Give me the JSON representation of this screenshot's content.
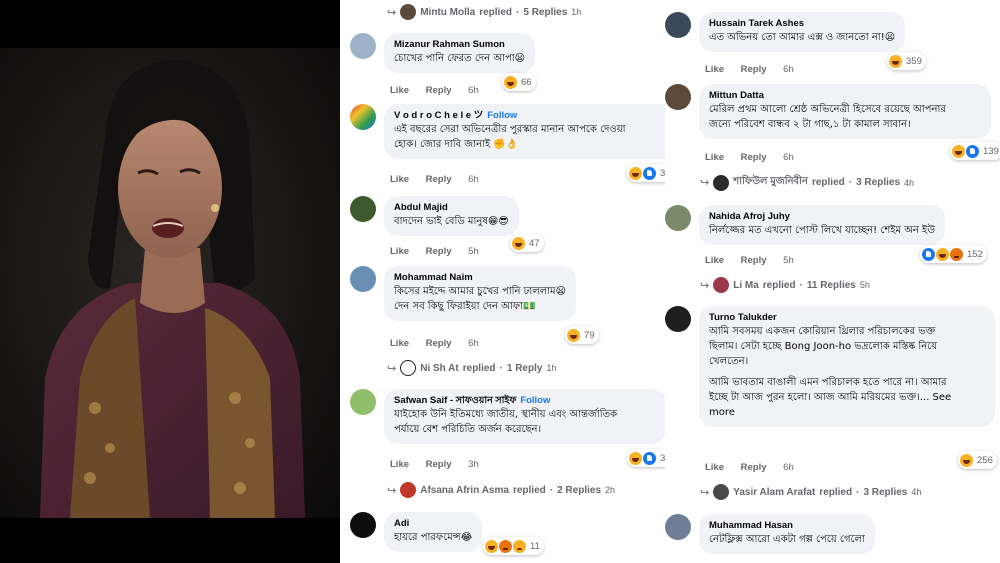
{
  "left_column": {
    "top_reply": {
      "author": "Mintu Molla",
      "action": "replied",
      "count": "5 Replies",
      "time": "1h"
    },
    "comments": [
      {
        "name": "Mizanur Rahman Sumon",
        "follow": "",
        "lines": [
          "চোখের পানি ফেরত দেন আপা😦"
        ],
        "like": "Like",
        "reply": "Reply",
        "time": "6h",
        "reactions": [
          "haha"
        ],
        "count": "66"
      },
      {
        "name": "V o d r o C h e l e ツ",
        "follow": "Follow",
        "lines": [
          "এই বছরের সেরা অভিনেত্রীর পুরস্কার মানান আপকে দেওয়া",
          "হোক। জোর দাবি জানাই ✊👌"
        ],
        "like": "Like",
        "reply": "Reply",
        "time": "6h",
        "reactions": [
          "haha",
          "like"
        ],
        "count": "30"
      },
      {
        "name": "Abdul Majid",
        "follow": "",
        "lines": [
          "বাদদেন ভাই বেডি মানুষ😁😎"
        ],
        "like": "Like",
        "reply": "Reply",
        "time": "5h",
        "reactions": [
          "haha"
        ],
        "count": "47"
      },
      {
        "name": "Mohammad Naim",
        "follow": "",
        "lines": [
          "কিসের মইদ্দে আমার চুখের পানি ঢাললাম😦",
          "দেন সব কিছু ফিরাইয়া দেন আফা💵"
        ],
        "like": "Like",
        "reply": "Reply",
        "time": "6h",
        "reactions": [
          "haha"
        ],
        "count": "79"
      },
      {
        "name": "Safwan Saif - সাফওয়ান সাইফ",
        "follow": "Follow",
        "lines": [
          "যাইহোক উনি ইতিমধ্যে জাতীয়, স্থানীয় এবং আন্তর্জাতিক",
          "পর্যায়ে বেশ পরিচিতি অর্জন করেছেন।"
        ],
        "like": "Like",
        "reply": "Reply",
        "time": "3h",
        "reactions": [
          "haha",
          "like"
        ],
        "count": "32"
      },
      {
        "name": "Adi",
        "follow": "",
        "lines": [
          "হায়রে পারফমেন্স😂"
        ],
        "like": "",
        "reply": "",
        "time": "",
        "reactions": [
          "haha",
          "angry",
          "sad"
        ],
        "count": "11"
      }
    ],
    "reply_links": [
      {
        "author": "Ni Sh At",
        "action": "replied",
        "count": "1 Reply",
        "time": "1h"
      },
      {
        "author": "Afsana Afrin Asma",
        "action": "replied",
        "count": "2 Replies",
        "time": "2h"
      }
    ]
  },
  "right_column": {
    "comments": [
      {
        "name": "Hussain Tarek Ashes",
        "follow": "",
        "lines": [
          "এত অভিনয় তো আমার এক্স ও জানতো না!😦"
        ],
        "like": "Like",
        "reply": "Reply",
        "time": "6h",
        "reactions": [
          "haha"
        ],
        "count": "359"
      },
      {
        "name": "Mittun Datta",
        "follow": "",
        "lines": [
          "মেরিল প্রথম আলো শ্রেষ্ঠ অভিনেত্রী হিসেবে রয়েছে আপনার",
          "জন্যে পরিবেশ বান্ধব ২ টা গাছ,১ টা কামাল সাবান।"
        ],
        "like": "Like",
        "reply": "Reply",
        "time": "6h",
        "reactions": [
          "haha",
          "like"
        ],
        "count": "139"
      },
      {
        "name": "Nahida Afroj Juhy",
        "follow": "",
        "lines": [
          "নির্লজ্জের মত এখনো পোস্ট লিখে যাচ্ছেন! শেইম অন ইউ"
        ],
        "like": "Like",
        "reply": "Reply",
        "time": "5h",
        "reactions": [
          "like",
          "haha",
          "angry"
        ],
        "count": "152"
      },
      {
        "name": "Turno Talukder",
        "follow": "",
        "lines": [
          "আমি সবসময় একজন কোরিয়ান থ্রিলার পরিচালকের ভক্ত",
          "ছিলাম। সেটা হচ্ছে Bong Joon-ho ভদ্রলোক মস্তিষ্ক নিয়ে",
          "খেলতেন।",
          "",
          "আমি ভাবতাম বাঙালী এমন পরিচালক হতে পারে না। আমার",
          "ইচ্ছে টা আজ পুরন হলো। আজ আমি মরিয়মের ভক্ত।... See",
          "more"
        ],
        "like": "Like",
        "reply": "Reply",
        "time": "6h",
        "reactions": [
          "haha"
        ],
        "count": "256"
      },
      {
        "name": "Muhammad Hasan",
        "follow": "",
        "lines": [
          "নেটফ্লিক্স আরো একটা গল্প পেয়ে গেলো"
        ],
        "like": "",
        "reply": "",
        "time": "",
        "reactions": [],
        "count": ""
      }
    ],
    "reply_links": [
      {
        "author": "শাফিউল মুজনিবীন",
        "action": "replied",
        "count": "3 Replies",
        "time": "4h"
      },
      {
        "author": "Li Ma",
        "action": "replied",
        "count": "11 Replies",
        "time": "5h"
      },
      {
        "author": "Yasir Alam Arafat",
        "action": "replied",
        "count": "3 Replies",
        "time": "4h"
      }
    ]
  },
  "colors": {
    "bubble": "#f0f2f5",
    "meta": "#65676b",
    "follow": "#1877f2",
    "like": "#1877f2",
    "haha": "#f7b125",
    "angry": "#e9710f"
  }
}
